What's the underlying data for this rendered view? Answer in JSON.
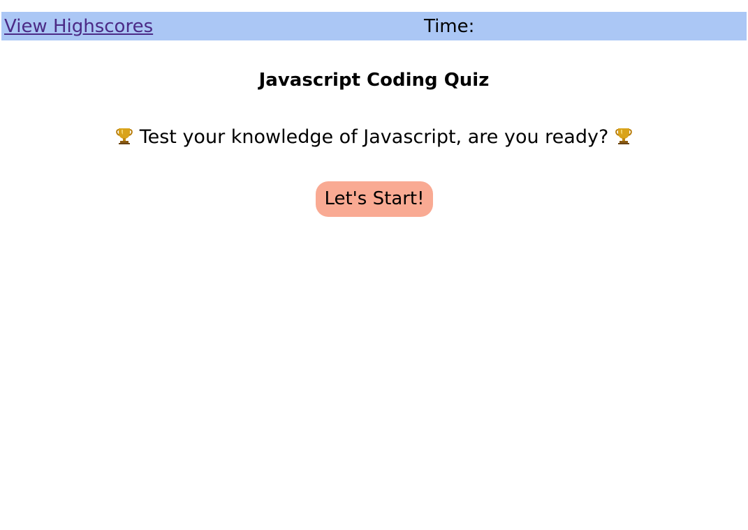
{
  "header": {
    "highscores_link": "View Highscores",
    "time_label": "Time:",
    "time_value": ""
  },
  "main": {
    "title": "Javascript Coding Quiz",
    "intro_text": "Test your knowledge of Javascript, are you ready?",
    "start_button": "Let's Start!"
  },
  "icons": {
    "left": "trophy-icon",
    "right": "trophy-icon"
  },
  "colors": {
    "header_background": "#abc7f5",
    "link": "#4b2a86",
    "start_button_background": "#f9aa93",
    "trophy_gold": "#d9a31a"
  }
}
